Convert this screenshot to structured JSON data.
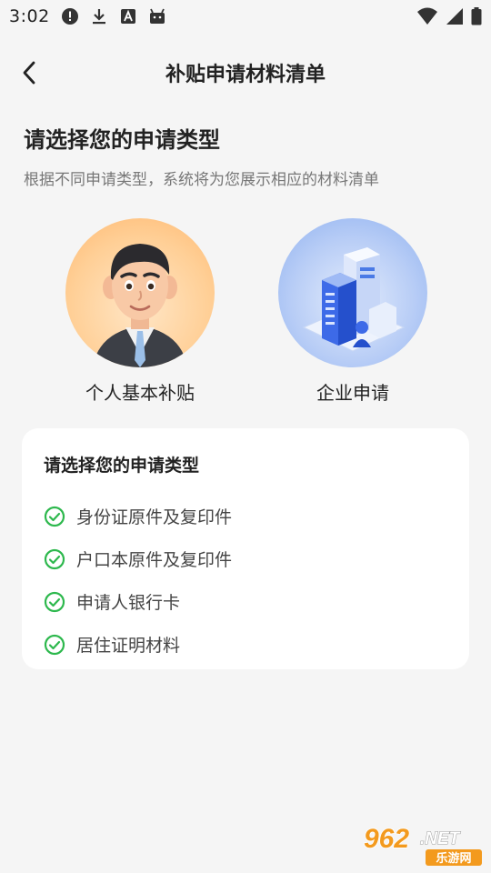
{
  "status_bar": {
    "time": "3:02",
    "left_icons": [
      "alert-icon",
      "download-icon",
      "a-letter-icon",
      "android-icon"
    ],
    "right_icons": [
      "wifi-icon",
      "cellular-icon",
      "battery-icon"
    ]
  },
  "app_bar": {
    "title": "补贴申请材料清单",
    "back_icon": "chevron-left-icon"
  },
  "intro": {
    "heading": "请选择您的申请类型",
    "subheading": "根据不同申请类型，系统将为您展示相应的材料清单"
  },
  "types": [
    {
      "label": "个人基本补贴",
      "image": "businessman-avatar"
    },
    {
      "label": "企业申请",
      "image": "office-buildings-illustration"
    }
  ],
  "requirements": {
    "title": "请选择您的申请类型",
    "items": [
      "身份证原件及复印件",
      "户口本原件及复印件",
      "申请人银行卡",
      "居住证明材料"
    ],
    "check_color": "#2db84d"
  },
  "watermark": {
    "brand": "962",
    "suffix": ".NET",
    "caption": "乐游网"
  }
}
